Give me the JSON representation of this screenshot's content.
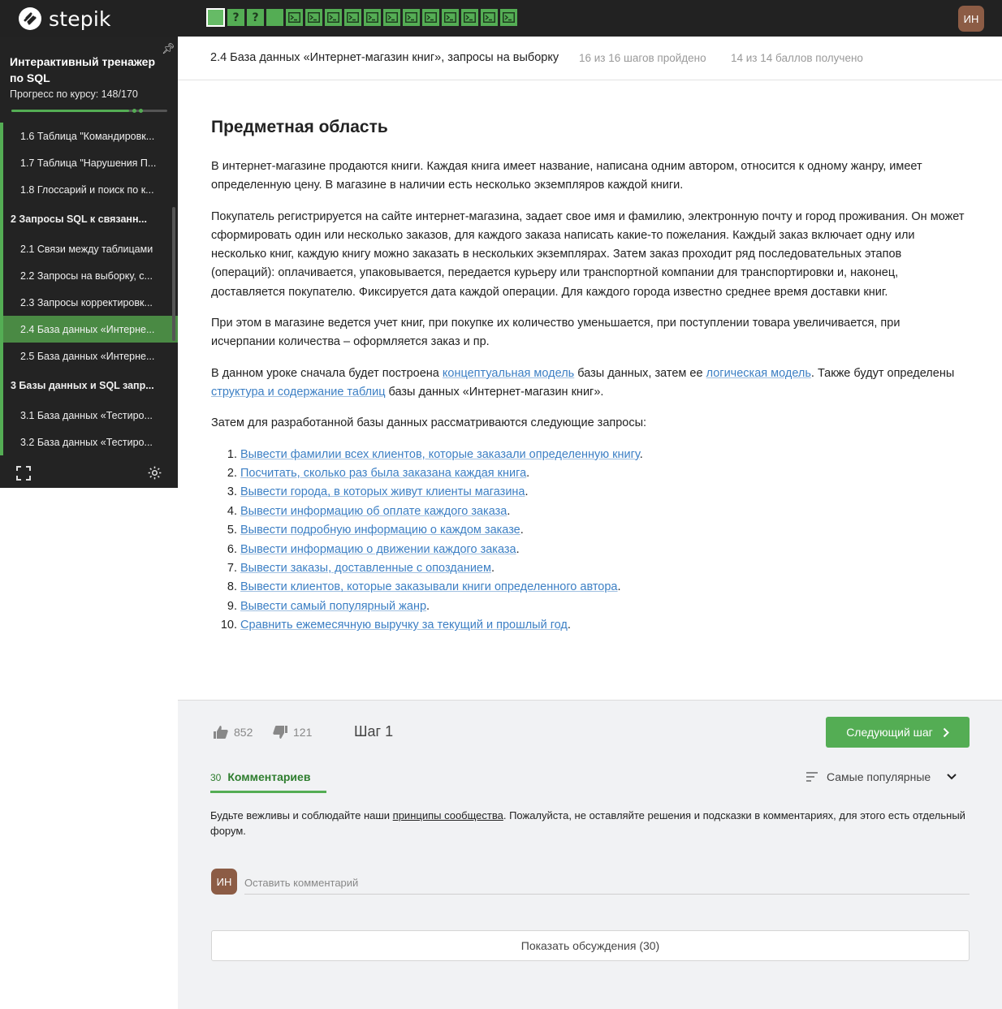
{
  "brand": {
    "name": "stepik"
  },
  "topbar": {
    "steps": [
      {
        "type": "done",
        "current": true,
        "label": ""
      },
      {
        "type": "quiz",
        "current": false,
        "label": "?"
      },
      {
        "type": "quiz",
        "current": false,
        "label": "?"
      },
      {
        "type": "done",
        "current": false,
        "label": ""
      },
      {
        "type": "code",
        "current": false,
        "label": ""
      },
      {
        "type": "code",
        "current": false,
        "label": ""
      },
      {
        "type": "code",
        "current": false,
        "label": ""
      },
      {
        "type": "code",
        "current": false,
        "label": ""
      },
      {
        "type": "code",
        "current": false,
        "label": ""
      },
      {
        "type": "code",
        "current": false,
        "label": ""
      },
      {
        "type": "code",
        "current": false,
        "label": ""
      },
      {
        "type": "code",
        "current": false,
        "label": ""
      },
      {
        "type": "code",
        "current": false,
        "label": ""
      },
      {
        "type": "code",
        "current": false,
        "label": ""
      },
      {
        "type": "code",
        "current": false,
        "label": ""
      },
      {
        "type": "code",
        "current": false,
        "label": ""
      }
    ],
    "user_initials": "ИН"
  },
  "sidebar": {
    "course_title": "Интерактивный тренажер по SQL",
    "progress_label": "Прогресс по курсу:",
    "progress_value": "148/170",
    "progress_fraction": 0.87,
    "items": [
      {
        "label": "1.6  Таблица \"Командировк...",
        "kind": "lesson",
        "active": false
      },
      {
        "label": "1.7  Таблица \"Нарушения П...",
        "kind": "lesson",
        "active": false
      },
      {
        "label": "1.8  Глоссарий и поиск по к...",
        "kind": "lesson",
        "active": false
      },
      {
        "label": "2   Запросы SQL к связанн...",
        "kind": "section",
        "active": false
      },
      {
        "label": "2.1  Связи между таблицами",
        "kind": "lesson",
        "active": false
      },
      {
        "label": "2.2  Запросы на выборку, с...",
        "kind": "lesson",
        "active": false
      },
      {
        "label": "2.3  Запросы корректировк...",
        "kind": "lesson",
        "active": false
      },
      {
        "label": "2.4  База данных «Интерне...",
        "kind": "lesson",
        "active": true
      },
      {
        "label": "2.5  База данных «Интерне...",
        "kind": "lesson",
        "active": false
      },
      {
        "label": "3  Базы данных и SQL запр...",
        "kind": "section",
        "active": false
      },
      {
        "label": "3.1  База данных «Тестиро...",
        "kind": "lesson",
        "active": false
      },
      {
        "label": "3.2  База данных «Тестиро...",
        "kind": "lesson",
        "active": false
      }
    ]
  },
  "header": {
    "lesson_title": "2.4 База данных «Интернет-магазин книг», запросы на выборку",
    "steps_done": "16 из 16 шагов пройдено",
    "points": "14 из 14 баллов  получено"
  },
  "content": {
    "heading": "Предметная область",
    "p1": "В интернет-магазине продаются книги. Каждая книга имеет название, написана одним автором, относится к одному жанру, имеет определенную цену. В магазине в наличии есть несколько экземпляров каждой книги.",
    "p2": "Покупатель регистрируется на сайте интернет-магазина, задает свое имя и фамилию, электронную почту и город проживания. Он может сформировать один или несколько заказов, для каждого заказа написать какие-то пожелания. Каждый заказ включает одну или несколько книг, каждую книгу можно заказать в нескольких экземплярах. Затем заказ проходит ряд последовательных этапов (операций): оплачивается, упаковывается, передается курьеру или транспортной компании для транспортировки и, наконец, доставляется покупателю. Фиксируется дата каждой операции. Для каждого города известно среднее время доставки книг.",
    "p3": "При этом в магазине ведется учет книг, при покупке их количество уменьшается, при поступлении товара увеличивается, при исчерпании количества – оформляется заказ и пр.",
    "p4_a": "В данном уроке сначала будет построена ",
    "p4_link1": "концептуальная модель",
    "p4_b": " базы данных, затем ее ",
    "p4_link2": "логическая модель",
    "p4_c": ". Также будут определены",
    "p4_link3": " структура и содержание таблиц",
    "p4_d": " базы данных «Интернет-магазин книг».",
    "p5": "Затем для разработанной базы данных рассматриваются следующие запросы:",
    "queries": [
      "Вывести фамилии всех клиентов, которые заказали определенную книгу",
      "Посчитать, сколько раз была заказана каждая книга",
      "Вывести города, в которых живут клиенты магазина",
      "Вывести информацию об оплате каждого заказа",
      "Вывести подробную информацию о каждом заказе",
      "Вывести информацию о движении каждого заказа",
      "Вывести заказы, доставленные с опозданием",
      "Вывести клиентов, которые заказывали книги определенного автора",
      "Вывести самый популярный жанр",
      "Сравнить ежемесячную выручку за текущий и прошлый год"
    ]
  },
  "footer": {
    "likes": "852",
    "dislikes": "121",
    "step_label": "Шаг 1",
    "next_button": "Следующий шаг",
    "comments_count": "30",
    "comments_label": "Комментариев",
    "sort_label": "Самые популярные",
    "rules_a": "Будьте вежливы и соблюдайте наши ",
    "rules_link": "принципы сообщества",
    "rules_b": ". Пожалуйста, не оставляйте решения и подсказки в комментариях, для этого есть отдельный форум.",
    "user_initials": "ИН",
    "comment_placeholder": "Оставить комментарий",
    "show_discussions": "Показать обсуждения (30)"
  },
  "colors": {
    "accent": "#54ad54",
    "topbar": "#222222",
    "link": "#3c7fc4",
    "avatar": "#8c5c45"
  }
}
